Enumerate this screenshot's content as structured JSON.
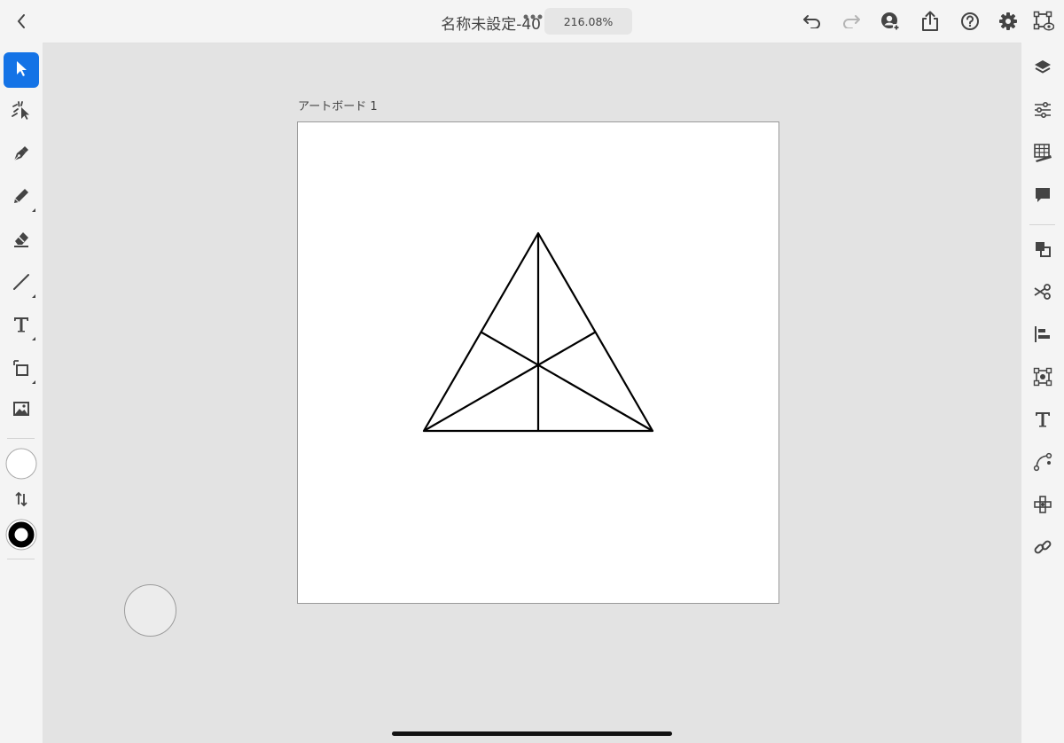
{
  "header": {
    "document_title": "名称未設定-40",
    "zoom_level": "216.08%"
  },
  "canvas": {
    "artboard_label": "アートボード 1"
  },
  "left_tools": [
    {
      "name": "selection-tool",
      "icon": "arrow-pointer-icon",
      "active": true
    },
    {
      "name": "direct-selection-tool",
      "icon": "sparkle-select-icon"
    },
    {
      "name": "pen-tool",
      "icon": "pen-nib-icon"
    },
    {
      "name": "pencil-tool",
      "icon": "pencil-icon"
    },
    {
      "name": "eraser-tool",
      "icon": "eraser-icon"
    },
    {
      "name": "line-tool",
      "icon": "line-icon"
    },
    {
      "name": "type-tool",
      "icon": "type-icon"
    },
    {
      "name": "shape-tool",
      "icon": "rectangle-icon"
    },
    {
      "name": "place-image-tool",
      "icon": "image-icon"
    }
  ],
  "right_panel": [
    "layers-icon",
    "properties-icon",
    "swatches-icon",
    "comments-icon",
    "arrange-icon",
    "scissors-icon",
    "align-icon",
    "transform-icon",
    "type-panel-icon",
    "path-icon",
    "repeat-icon",
    "link-icon"
  ],
  "colors": {
    "accent": "#1473e6",
    "fill_color": "#ffffff",
    "stroke_color": "#000000"
  }
}
